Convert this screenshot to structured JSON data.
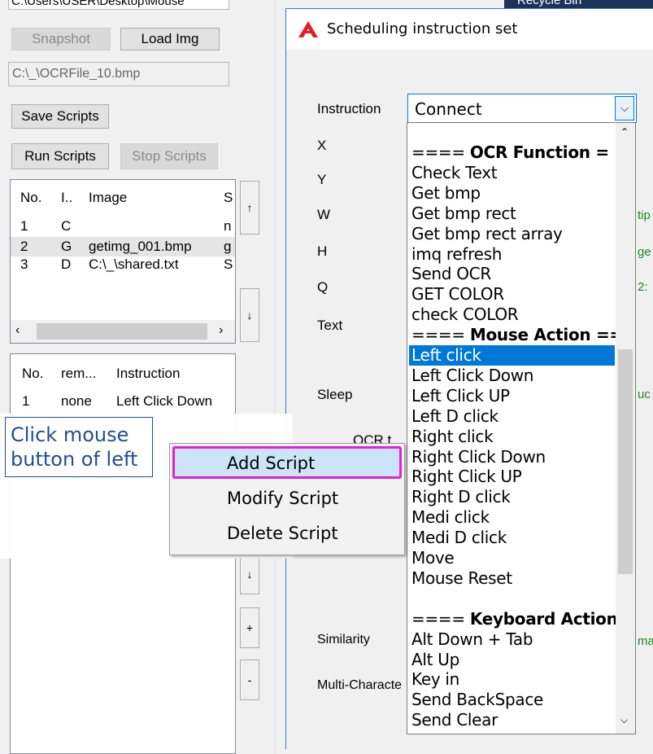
{
  "main": {
    "path_field": "C:\\Users\\USER\\Desktop\\Mouse",
    "snapshot_label": "Snapshot",
    "load_img_label": "Load Img",
    "file_field": "C:\\_\\OCRFile_10.bmp",
    "save_scripts_label": "Save Scripts",
    "run_scripts_label": "Run Scripts",
    "stop_scripts_label": "Stop Scripts",
    "script_list": {
      "headers": [
        "No.",
        "I..",
        "Image",
        "S"
      ],
      "rows": [
        [
          "1",
          "C",
          "",
          "n"
        ],
        [
          "2",
          "G",
          "getimg_001.bmp",
          "g"
        ],
        [
          "3",
          "D",
          "C:\\_\\shared.txt",
          "S"
        ]
      ]
    },
    "up_arrow": "↑",
    "down_arrow": "↓",
    "plus_label": "+",
    "minus_label": "-",
    "down_small": "↓",
    "instr_list": {
      "headers": [
        "No.",
        "rem...",
        "Instruction"
      ],
      "rows": [
        [
          "1",
          "none",
          "Left Click Down"
        ]
      ]
    }
  },
  "desktop": {
    "recycle_bin": "Recycle Bin"
  },
  "dialog": {
    "title": "Scheduling instruction set",
    "labels": {
      "instruction": "Instruction",
      "x": "X",
      "y": "Y",
      "w": "W",
      "h": "H",
      "q": "Q",
      "text": "Text",
      "sleep": "Sleep",
      "ocr": "OCR t",
      "similarity": "Similarity",
      "multi": "Multi-Characte"
    },
    "instruction_value": "Connect",
    "right_clips": [
      "tip",
      "ge",
      "2:",
      "uc",
      "ma"
    ],
    "accent_color": "#e02020"
  },
  "dropdown": {
    "items": [
      {
        "text": "==== OCR Function =",
        "bold_part": "OCR Function",
        "type": "header"
      },
      {
        "text": "Check Text"
      },
      {
        "text": "Get bmp"
      },
      {
        "text": "Get bmp rect"
      },
      {
        "text": "Get bmp rect array"
      },
      {
        "text": "imq refresh"
      },
      {
        "text": "Send OCR"
      },
      {
        "text": "GET COLOR"
      },
      {
        "text": "check COLOR"
      },
      {
        "text": "==== Mouse Action ==",
        "type": "header"
      },
      {
        "text": "Left click",
        "selected": true
      },
      {
        "text": "Left Click Down"
      },
      {
        "text": "Left Click UP"
      },
      {
        "text": "Left D click"
      },
      {
        "text": "Right click"
      },
      {
        "text": "Right Click Down"
      },
      {
        "text": "Right Click UP"
      },
      {
        "text": "Right D click"
      },
      {
        "text": "Medi click"
      },
      {
        "text": "Medi D click"
      },
      {
        "text": "Move"
      },
      {
        "text": "Mouse Reset"
      },
      {
        "text": ""
      },
      {
        "text": "==== Keyboard Action",
        "type": "header"
      },
      {
        "text": "Alt Down + Tab"
      },
      {
        "text": "Alt Up"
      },
      {
        "text": "Key in"
      },
      {
        "text": "Send BackSpace"
      },
      {
        "text": "Send Clear"
      }
    ],
    "selected_color": "#0078d7"
  },
  "context_menu": {
    "items": [
      "Add Script",
      "Modify Script",
      "Delete Script"
    ],
    "highlight_color": "#e020e0"
  },
  "tooltip": {
    "line1": "Click mouse",
    "line2": "button of left"
  }
}
